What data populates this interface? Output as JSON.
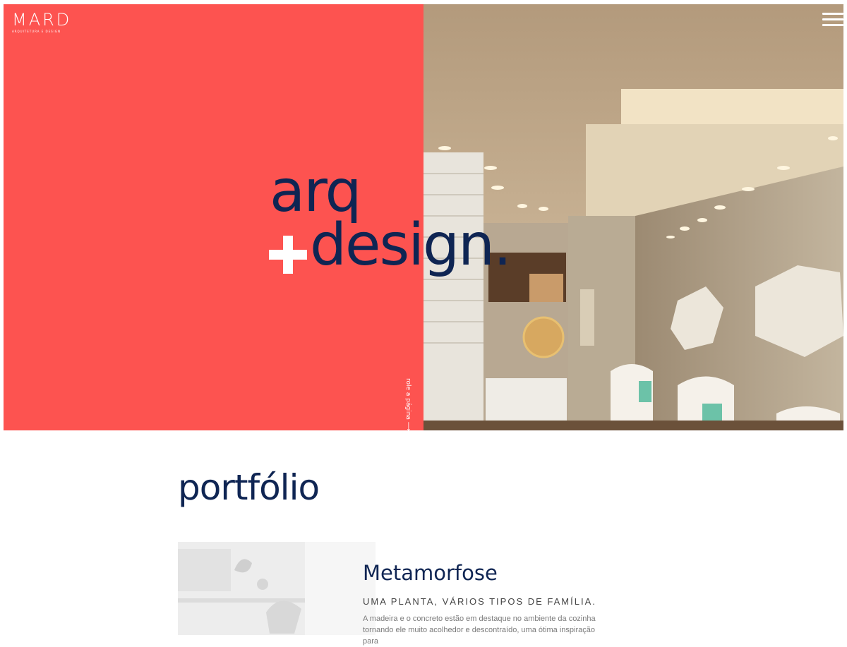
{
  "header": {
    "logo_text": "MARD",
    "logo_subtitle": "ARQUITETURA E DESIGN",
    "menu_icon": "hamburger-icon"
  },
  "hero": {
    "headline_line1": "arq",
    "headline_line2": "design.",
    "plus_icon": "plus-icon",
    "scroll_hint": "role a página ⟶",
    "colors": {
      "red": "#fd5350",
      "navy": "#0f2553"
    }
  },
  "portfolio": {
    "title": "portfólio",
    "projects": [
      {
        "name": "Metamorfose",
        "tagline": "UMA PLANTA, VÁRIOS TIPOS DE FAMÍLIA.",
        "description": "A madeira e o concreto estão em destaque no ambiente da cozinha tornando ele muito acolhedor e descontraído, uma ótima inspiração para"
      }
    ]
  }
}
